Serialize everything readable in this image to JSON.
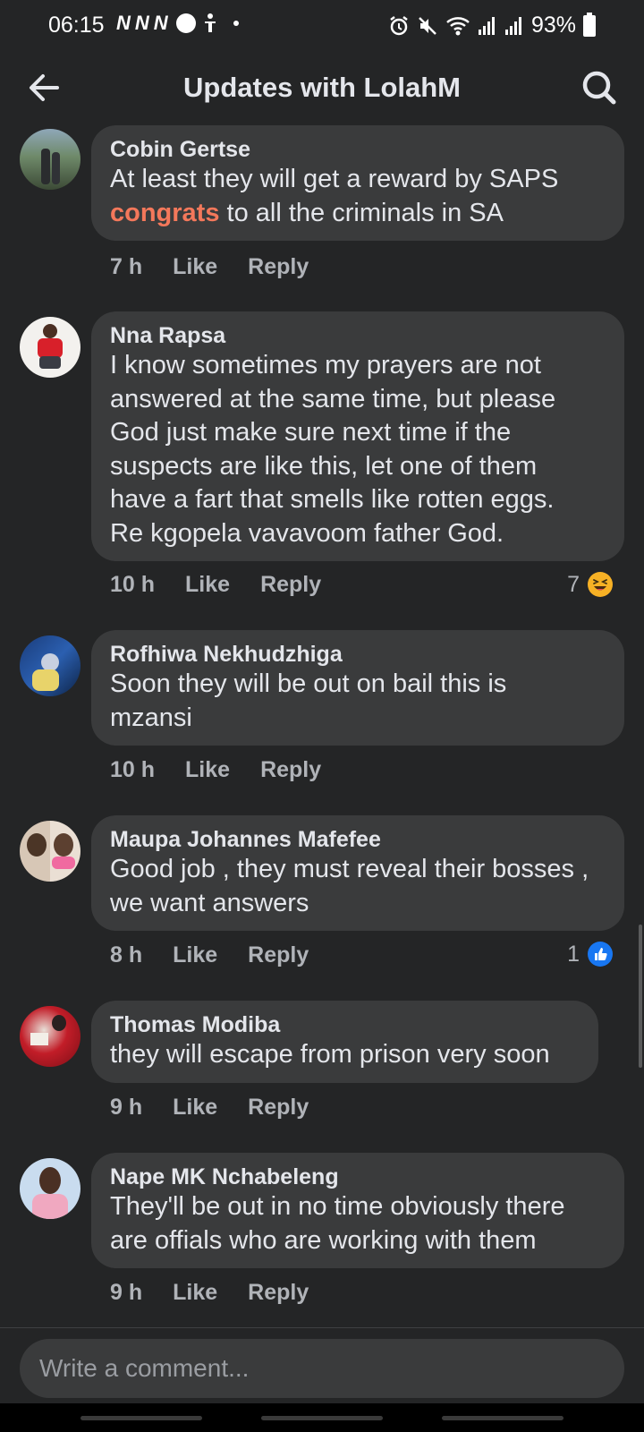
{
  "status_bar": {
    "time": "06:15",
    "notif_glyphs": [
      "N",
      "N",
      "N"
    ],
    "battery": "93%"
  },
  "header": {
    "title": "Updates with LolahM"
  },
  "comments": [
    {
      "name": "Cobin Gertse",
      "text_before": "At least they will get a reward by SAPS",
      "highlight": "congrats",
      "text_after": " to all the criminals in SA",
      "time": "7 h",
      "like": "Like",
      "reply": "Reply"
    },
    {
      "name": "Nna Rapsa",
      "lines": [
        "I know sometimes my prayers are not",
        "answered at the same time, but please",
        "God just make sure next time if the",
        "suspects are like this, let one of them",
        "have a fart that smells like rotten eggs.",
        "Re kgopela vavavoom father God."
      ],
      "time": "10 h",
      "like": "Like",
      "reply": "Reply",
      "reaction_count": "7",
      "reaction_icon": "haha-emoji-icon"
    },
    {
      "name": "Rofhiwa Nekhudzhiga",
      "lines": [
        "Soon they will be out on bail this is",
        "mzansi"
      ],
      "time": "10 h",
      "like": "Like",
      "reply": "Reply"
    },
    {
      "name": "Maupa Johannes Mafefee",
      "lines": [
        "Good job , they must reveal their bosses ,",
        "we want answers"
      ],
      "time": "8 h",
      "like": "Like",
      "reply": "Reply",
      "reaction_count": "1",
      "reaction_icon": "like-thumb-icon"
    },
    {
      "name": "Thomas Modiba",
      "lines": [
        "they will escape from prison very soon"
      ],
      "time": "9 h",
      "like": "Like",
      "reply": "Reply"
    },
    {
      "name": "Nape MK Nchabeleng",
      "lines": [
        "They'll be out in no time obviously there",
        "are offials who are working with them"
      ],
      "time": "9 h",
      "like": "Like",
      "reply": "Reply"
    }
  ],
  "composer": {
    "placeholder": "Write a comment..."
  },
  "colors": {
    "background": "#242526",
    "bubble": "#3a3b3c",
    "highlight": "#f4785b",
    "like_blue": "#1877f2",
    "haha_yellow": "#f7b125"
  }
}
